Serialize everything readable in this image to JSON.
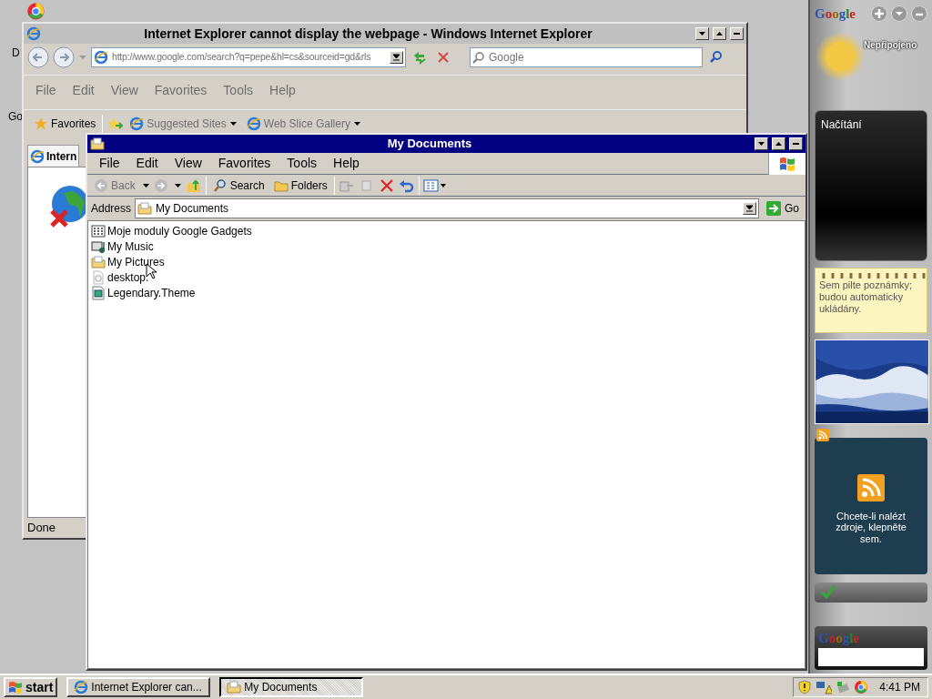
{
  "desktop_labels": [
    "D",
    "Go"
  ],
  "ie_window": {
    "title": "Internet Explorer cannot display the webpage - Windows Internet Explorer",
    "active": false,
    "address": "http://www.google.com/search?q=pepe&hl=cs&sourceid=gd&rls",
    "search_placeholder": "Google",
    "menu": [
      {
        "label": "File",
        "disabled": true
      },
      {
        "label": "Edit",
        "disabled": true
      },
      {
        "label": "View",
        "disabled": true
      },
      {
        "label": "Favorites",
        "disabled": true
      },
      {
        "label": "Tools",
        "disabled": true
      },
      {
        "label": "Help",
        "disabled": true
      }
    ],
    "favorites_bar": [
      {
        "label": "Favorites",
        "kind": "star",
        "disabled": false
      },
      {
        "label": "Suggested Sites",
        "kind": "dropdown",
        "disabled": true
      },
      {
        "label": "Web Slice Gallery",
        "kind": "dropdown",
        "disabled": true
      }
    ],
    "tab": "Intern",
    "status": "Done"
  },
  "explorer_window": {
    "title": "My Documents",
    "active": true,
    "menu": [
      "File",
      "Edit",
      "View",
      "Favorites",
      "Tools",
      "Help"
    ],
    "toolbar": [
      {
        "label": "Back",
        "kind": "back",
        "disabled": true
      },
      {
        "label": "Search",
        "kind": "search",
        "disabled": false
      },
      {
        "label": "Folders",
        "kind": "folders",
        "disabled": false
      }
    ],
    "address_label": "Address",
    "address": "My Documents",
    "go": "Go",
    "files": [
      {
        "name": "Moje moduly Google Gadgets",
        "kind": "gadgets"
      },
      {
        "name": "My Music",
        "kind": "music"
      },
      {
        "name": "My Pictures",
        "kind": "pictures"
      },
      {
        "name": "desktop.",
        "kind": "settings"
      },
      {
        "name": "Legendary.Theme",
        "kind": "theme"
      }
    ]
  },
  "sidebar": {
    "logo": "Google",
    "weather_status": "Nepřipojeno",
    "loading_text": "Načítání",
    "notes_text": "Sem pilte poznámky; budou automaticky ukládány.",
    "feed_text": "Chcete-li nalézt zdroje, klepněte sem.",
    "search_logo": "Google"
  },
  "taskbar": {
    "start": "start",
    "tasks": [
      {
        "label": "Internet Explorer can...",
        "kind": "browser",
        "selected": false
      },
      {
        "label": "My Documents",
        "kind": "folder",
        "selected": true
      }
    ],
    "clock": "4:41 PM"
  }
}
